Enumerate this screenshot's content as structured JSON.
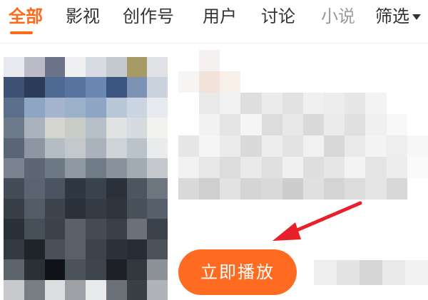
{
  "tabs": [
    {
      "label": "全部",
      "active": true
    },
    {
      "label": "影视",
      "active": false
    },
    {
      "label": "创作号",
      "active": false
    },
    {
      "label": "用户",
      "active": false
    },
    {
      "label": "讨论",
      "active": false
    },
    {
      "label": "小说",
      "active": false
    }
  ],
  "filter": {
    "label": "筛选",
    "icon": "caret-down-icon"
  },
  "result": {
    "play_button_label": "立即播放",
    "thumbnail_icon": "pixelated-thumbnail",
    "title_icon": "pixelated-text"
  },
  "colors": {
    "accent": "#ff6a1a",
    "button": "#ff6b20",
    "annotation_arrow": "#e8202a"
  }
}
